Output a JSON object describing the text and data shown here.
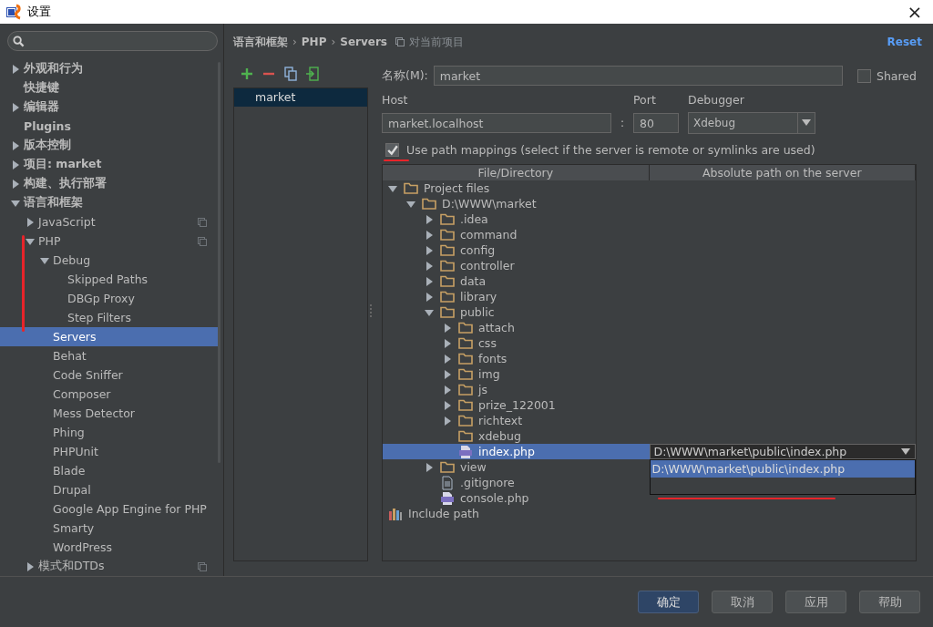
{
  "window": {
    "title": "设置",
    "close": "×"
  },
  "sidebar": {
    "items": [
      {
        "label": "外观和行为",
        "kind": "group",
        "expanded": false,
        "selected": false,
        "project_scope": false
      },
      {
        "label": "快捷键",
        "kind": "leaf",
        "selected": false,
        "project_scope": false
      },
      {
        "label": "编辑器",
        "kind": "group",
        "expanded": false,
        "selected": false,
        "project_scope": false
      },
      {
        "label": "Plugins",
        "kind": "leaf",
        "selected": false,
        "project_scope": false
      },
      {
        "label": "版本控制",
        "kind": "group",
        "expanded": false,
        "selected": false,
        "project_scope": false
      },
      {
        "label": "项目: market",
        "kind": "group",
        "expanded": false,
        "selected": false,
        "project_scope": false
      },
      {
        "label": "构建、执行部署",
        "kind": "group",
        "expanded": false,
        "selected": false,
        "project_scope": false
      },
      {
        "label": "语言和框架",
        "kind": "group",
        "expanded": true,
        "selected": false,
        "project_scope": false,
        "children": [
          {
            "label": "JavaScript",
            "kind": "group",
            "expanded": false,
            "selected": false,
            "project_scope": true
          },
          {
            "label": "PHP",
            "kind": "group",
            "expanded": true,
            "selected": false,
            "project_scope": true,
            "children": [
              {
                "label": "Debug",
                "kind": "group",
                "expanded": true,
                "selected": false,
                "project_scope": false,
                "children": [
                  {
                    "label": "Skipped Paths",
                    "kind": "leaf",
                    "selected": false,
                    "project_scope": false
                  },
                  {
                    "label": "DBGp Proxy",
                    "kind": "leaf",
                    "selected": false,
                    "project_scope": false
                  },
                  {
                    "label": "Step Filters",
                    "kind": "leaf",
                    "selected": false,
                    "project_scope": false
                  }
                ]
              },
              {
                "label": "Servers",
                "kind": "leaf",
                "selected": true,
                "project_scope": false
              },
              {
                "label": "Behat",
                "kind": "leaf",
                "selected": false,
                "project_scope": false
              },
              {
                "label": "Code Sniffer",
                "kind": "leaf",
                "selected": false,
                "project_scope": false
              },
              {
                "label": "Composer",
                "kind": "leaf",
                "selected": false,
                "project_scope": false
              },
              {
                "label": "Mess Detector",
                "kind": "leaf",
                "selected": false,
                "project_scope": false
              },
              {
                "label": "Phing",
                "kind": "leaf",
                "selected": false,
                "project_scope": false
              },
              {
                "label": "PHPUnit",
                "kind": "leaf",
                "selected": false,
                "project_scope": false
              },
              {
                "label": "Blade",
                "kind": "leaf",
                "selected": false,
                "project_scope": false
              },
              {
                "label": "Drupal",
                "kind": "leaf",
                "selected": false,
                "project_scope": false
              },
              {
                "label": "Google App Engine for PHP",
                "kind": "leaf",
                "selected": false,
                "project_scope": false
              },
              {
                "label": "Smarty",
                "kind": "leaf",
                "selected": false,
                "project_scope": false
              },
              {
                "label": "WordPress",
                "kind": "leaf",
                "selected": false,
                "project_scope": false
              }
            ]
          },
          {
            "label": "模式和DTDs",
            "kind": "group",
            "expanded": false,
            "selected": false,
            "project_scope": true
          }
        ]
      }
    ]
  },
  "breadcrumb": {
    "parts": [
      "语言和框架",
      "PHP",
      "Servers"
    ],
    "separator": "›",
    "scope": "对当前项目",
    "reset": "Reset"
  },
  "servers": {
    "items": [
      {
        "name": "market",
        "selected": true
      }
    ]
  },
  "form": {
    "name_label": "名称(M):",
    "name_value": "market",
    "shared_label": "Shared",
    "shared": false,
    "host_label": "Host",
    "host_value": "market.localhost",
    "colon": ":",
    "port_label": "Port",
    "port_value": "80",
    "debugger_label": "Debugger",
    "debugger_value": "Xdebug",
    "use_mappings": true,
    "use_mappings_label": "Use path mappings (select if the server is remote or symlinks are used)"
  },
  "mappings": {
    "columns": [
      "File/Directory",
      "Absolute path on the server"
    ],
    "rows": [
      {
        "name": "Project files",
        "kind": "folder",
        "expanded": true,
        "selected": false,
        "children": [
          {
            "name": "D:\\WWW\\market",
            "kind": "folder",
            "expanded": true,
            "selected": false,
            "children": [
              {
                "name": ".idea",
                "kind": "folder",
                "expanded": false,
                "selected": false
              },
              {
                "name": "command",
                "kind": "folder",
                "expanded": false,
                "selected": false
              },
              {
                "name": "config",
                "kind": "folder",
                "expanded": false,
                "selected": false
              },
              {
                "name": "controller",
                "kind": "folder",
                "expanded": false,
                "selected": false
              },
              {
                "name": "data",
                "kind": "folder",
                "expanded": false,
                "selected": false
              },
              {
                "name": "library",
                "kind": "folder",
                "expanded": false,
                "selected": false
              },
              {
                "name": "public",
                "kind": "folder",
                "expanded": true,
                "selected": false,
                "children": [
                  {
                    "name": "attach",
                    "kind": "folder",
                    "expanded": false,
                    "selected": false
                  },
                  {
                    "name": "css",
                    "kind": "folder",
                    "expanded": false,
                    "selected": false
                  },
                  {
                    "name": "fonts",
                    "kind": "folder",
                    "expanded": false,
                    "selected": false
                  },
                  {
                    "name": "img",
                    "kind": "folder",
                    "expanded": false,
                    "selected": false
                  },
                  {
                    "name": "js",
                    "kind": "folder",
                    "expanded": false,
                    "selected": false
                  },
                  {
                    "name": "prize_122001",
                    "kind": "folder",
                    "expanded": false,
                    "selected": false
                  },
                  {
                    "name": "richtext",
                    "kind": "folder",
                    "expanded": false,
                    "selected": false
                  },
                  {
                    "name": "xdebug",
                    "kind": "empty-folder",
                    "selected": false
                  },
                  {
                    "name": "index.php",
                    "kind": "php",
                    "selected": true,
                    "server_path": "D:\\WWW\\market\\public\\index.php",
                    "popup": [
                      "D:\\WWW\\market\\public\\index.php"
                    ]
                  }
                ]
              },
              {
                "name": "view",
                "kind": "folder",
                "expanded": false,
                "selected": false
              },
              {
                "name": ".gitignore",
                "kind": "text",
                "selected": false
              },
              {
                "name": "console.php",
                "kind": "php",
                "selected": false
              }
            ]
          }
        ]
      },
      {
        "name": "Include path",
        "kind": "library",
        "selected": false
      }
    ]
  },
  "buttons": [
    {
      "label": "确定",
      "primary": true
    },
    {
      "label": "取消",
      "primary": false
    },
    {
      "label": "应用",
      "primary": false
    },
    {
      "label": "帮助",
      "primary": false
    }
  ]
}
